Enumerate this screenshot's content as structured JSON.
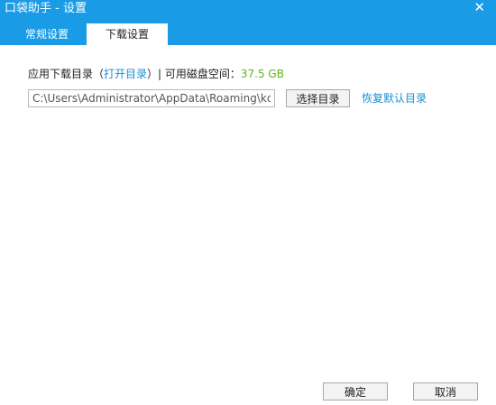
{
  "window": {
    "title": "口袋助手 - 设置",
    "close_glyph": "✕"
  },
  "tabs": {
    "general": "常规设置",
    "download": "下载设置"
  },
  "download": {
    "dir_label": "应用下载目录（",
    "open_dir_link": "打开目录",
    "close_paren_sep": "）| 可用磁盘空间：",
    "free_space": "37.5 GB",
    "path_value": "C:\\Users\\Administrator\\AppData\\Roaming\\kc",
    "choose_dir_button": "选择目录",
    "restore_default_link": "恢复默认目录"
  },
  "footer": {
    "ok_button": "确定",
    "cancel_button": "取消"
  },
  "colors": {
    "titlebar": "#1a9be6",
    "link": "#1a8fd6",
    "free_space": "#58b91a"
  }
}
